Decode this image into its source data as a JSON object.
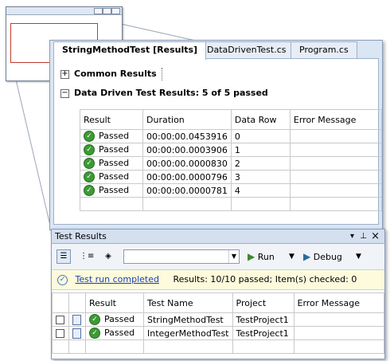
{
  "thumbnail": {
    "window_controls": [
      "minimize-icon",
      "maximize-icon",
      "close-icon"
    ]
  },
  "document": {
    "tabs": [
      {
        "label": "StringMethodTest [Results]",
        "active": true
      },
      {
        "label": "DataDrivenTest.cs",
        "active": false
      },
      {
        "label": "Program.cs",
        "active": false
      }
    ],
    "sections": {
      "common": {
        "toggle": "+",
        "label": "Common Results"
      },
      "data_driven": {
        "toggle": "−",
        "label": "Data Driven Test Results: 5 of 5 passed"
      }
    },
    "columns": [
      "Result",
      "Duration",
      "Data Row",
      "Error Message"
    ],
    "rows": [
      {
        "result": "Passed",
        "duration": "00:00:00.0453916",
        "data_row": "0",
        "error": ""
      },
      {
        "result": "Passed",
        "duration": "00:00:00.0003906",
        "data_row": "1",
        "error": ""
      },
      {
        "result": "Passed",
        "duration": "00:00:00.0000830",
        "data_row": "2",
        "error": ""
      },
      {
        "result": "Passed",
        "duration": "00:00:00.0000796",
        "data_row": "3",
        "error": ""
      },
      {
        "result": "Passed",
        "duration": "00:00:00.0000781",
        "data_row": "4",
        "error": ""
      }
    ]
  },
  "test_results": {
    "title": "Test Results",
    "title_controls": {
      "dropdown": "▾",
      "pin": "⊥",
      "close": "×"
    },
    "toolbar": {
      "run_label": "Run",
      "debug_label": "Debug",
      "combo_value": ""
    },
    "status": {
      "link": "Test run completed",
      "summary": "Results: 10/10 passed;  Item(s) checked: 0"
    },
    "columns": [
      "Result",
      "Test Name",
      "Project",
      "Error Message"
    ],
    "rows": [
      {
        "result": "Passed",
        "test_name": "StringMethodTest",
        "project": "TestProject1",
        "error": ""
      },
      {
        "result": "Passed",
        "test_name": "IntegerMethodTest",
        "project": "TestProject1",
        "error": ""
      }
    ]
  },
  "colors": {
    "pass_green": "#3d9a34",
    "title_bar": "#d4dff0",
    "status_bar": "#fdfbdc",
    "highlight_frame": "#c0392b"
  }
}
